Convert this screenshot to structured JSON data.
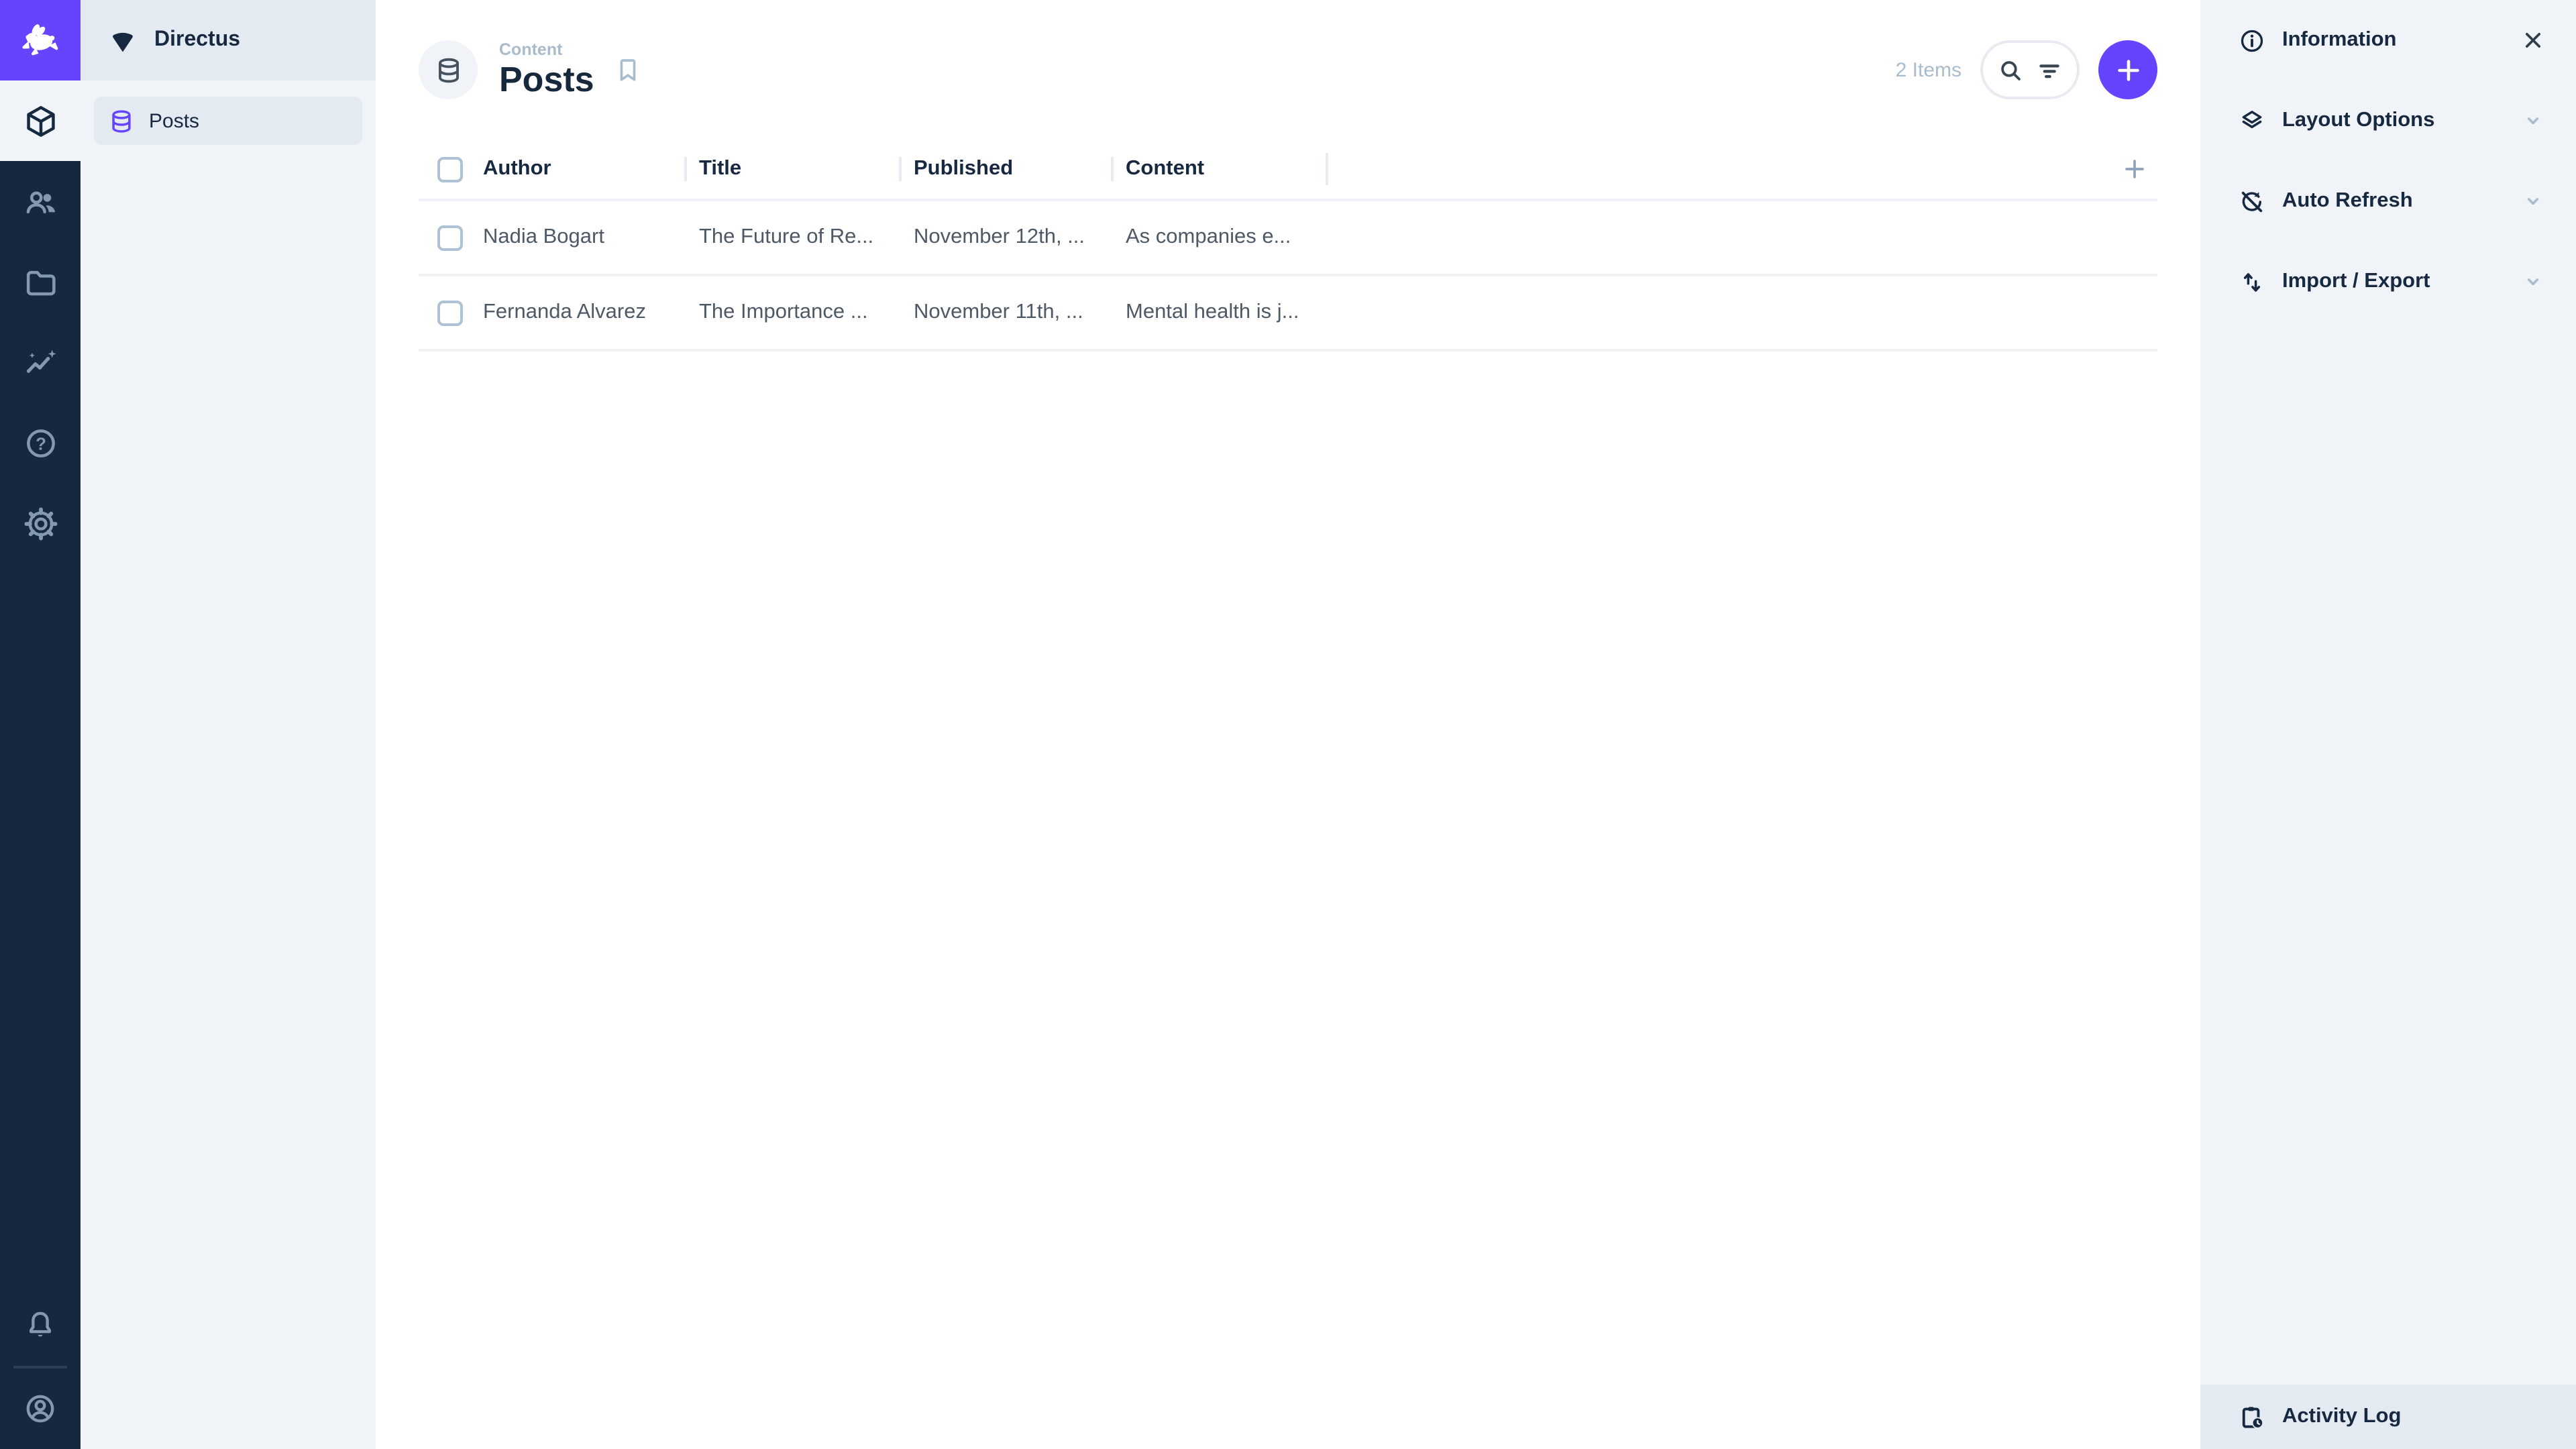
{
  "colors": {
    "accent": "#6644FF",
    "module_bar_bg": "#16283E",
    "module_icon": "#8498AE",
    "background_normal": "#F0F4F9",
    "background_alt": "#E4EAF1",
    "text_dark": "#172940",
    "text_subdued": "#A9BCCD",
    "cell_text": "#4D5966"
  },
  "module_bar": {
    "logo_icon": "rabbit-icon",
    "modules": [
      {
        "name": "content",
        "icon": "cube-icon",
        "active": true
      },
      {
        "name": "users",
        "icon": "people-icon",
        "active": false
      },
      {
        "name": "files",
        "icon": "folder-icon",
        "active": false
      },
      {
        "name": "insights",
        "icon": "insights-icon",
        "active": false
      },
      {
        "name": "help",
        "icon": "help-icon",
        "active": false
      },
      {
        "name": "settings",
        "icon": "gear-icon",
        "active": false
      }
    ],
    "bottom": [
      {
        "name": "notifications",
        "icon": "bell-icon"
      },
      {
        "name": "account",
        "icon": "account-circle-icon"
      }
    ]
  },
  "nav": {
    "project_name": "Directus",
    "project_icon": "fan-icon",
    "items": [
      {
        "label": "Posts",
        "icon": "database-icon",
        "active": true
      }
    ]
  },
  "header": {
    "breadcrumb": "Content",
    "title": "Posts",
    "collection_icon": "database-icon",
    "bookmark_icon": "bookmark-icon",
    "items_count": "2 Items",
    "search_icon": "search-icon",
    "filter_icon": "filter-icon",
    "add_icon": "plus-icon"
  },
  "table": {
    "columns": [
      "Author",
      "Title",
      "Published",
      "Content"
    ],
    "rows": [
      [
        "Nadia Bogart",
        "The Future of Re...",
        "November 12th, ...",
        "As companies e..."
      ],
      [
        "Fernanda Alvarez",
        "The Importance ...",
        "November 11th, ...",
        "Mental health is j..."
      ]
    ],
    "add_column_icon": "plus-icon"
  },
  "sidebar": {
    "sections": [
      {
        "label": "Information",
        "icon": "info-icon",
        "close_icon": "close-icon"
      },
      {
        "label": "Layout Options",
        "icon": "layers-icon",
        "chevron": "chevron-down-icon"
      },
      {
        "label": "Auto Refresh",
        "icon": "sync-disabled-icon",
        "chevron": "chevron-down-icon"
      },
      {
        "label": "Import / Export",
        "icon": "swap-vert-icon",
        "chevron": "chevron-down-icon"
      }
    ],
    "footer": {
      "label": "Activity Log",
      "icon": "clipboard-clock-icon"
    }
  }
}
